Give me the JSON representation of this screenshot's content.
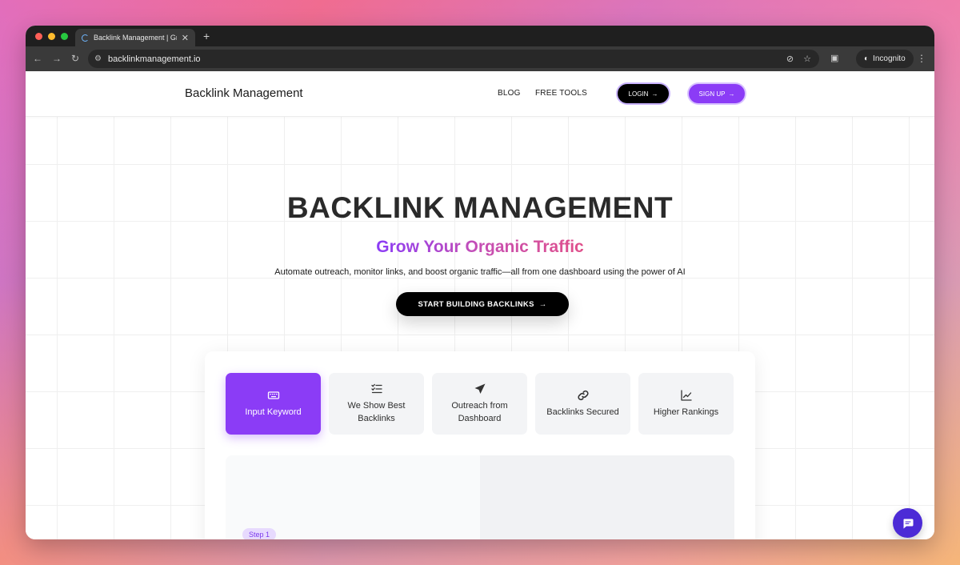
{
  "browser": {
    "tab_title": "Backlink Management | Grow",
    "url": "backlinkmanagement.io",
    "incognito_label": "Incognito"
  },
  "header": {
    "logo": "Backlink Management",
    "nav": [
      "BLOG",
      "FREE TOOLS"
    ],
    "login_label": "LOGIN",
    "signup_label": "SIGN UP"
  },
  "hero": {
    "title": "BACKLINK MANAGEMENT",
    "subtitle": "Grow Your Organic Traffic",
    "description": "Automate outreach, monitor links, and boost organic traffic—all from one dashboard using the power of AI",
    "cta_label": "START BUILDING BACKLINKS"
  },
  "steps": [
    {
      "label": "Input Keyword",
      "icon": "keyboard-icon",
      "active": true
    },
    {
      "label": "We Show Best Backlinks",
      "icon": "list-check-icon",
      "active": false
    },
    {
      "label": "Outreach from Dashboard",
      "icon": "send-icon",
      "active": false
    },
    {
      "label": "Backlinks Secured",
      "icon": "link-icon",
      "active": false
    },
    {
      "label": "Higher Rankings",
      "icon": "chart-line-icon",
      "active": false
    }
  ],
  "preview": {
    "step_badge": "Step 1"
  },
  "colors": {
    "accent": "#8b3cf6",
    "chat_fab": "#4c2bd6"
  }
}
